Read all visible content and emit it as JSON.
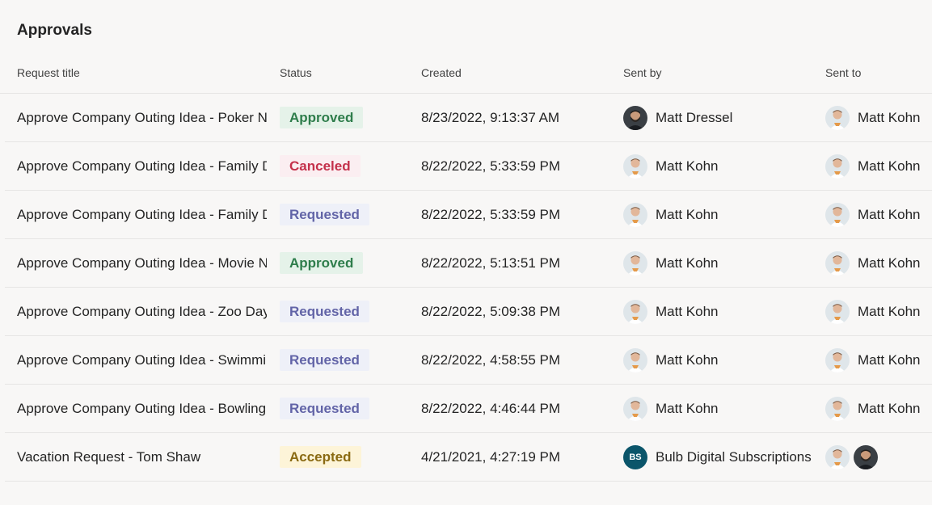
{
  "page": {
    "title": "Approvals"
  },
  "columns": {
    "title": "Request title",
    "status": "Status",
    "created": "Created",
    "sent_by": "Sent by",
    "sent_to": "Sent to"
  },
  "rows": [
    {
      "title": "Approve Company Outing Idea - Poker Night",
      "status": "Approved",
      "status_kind": "approved",
      "created": "8/23/2022, 9:13:37 AM",
      "sent_by": {
        "name": "Matt Dressel",
        "avatar": "bearded-man-avatar"
      },
      "sent_to": [
        {
          "name": "Matt Kohn",
          "avatar": "matt-kohn-avatar"
        }
      ]
    },
    {
      "title": "Approve Company Outing Idea - Family Day",
      "status": "Canceled",
      "status_kind": "canceled",
      "created": "8/22/2022, 5:33:59 PM",
      "sent_by": {
        "name": "Matt Kohn",
        "avatar": "matt-kohn-avatar"
      },
      "sent_to": [
        {
          "name": "Matt Kohn",
          "avatar": "matt-kohn-avatar"
        }
      ]
    },
    {
      "title": "Approve Company Outing Idea - Family Day",
      "status": "Requested",
      "status_kind": "requested",
      "created": "8/22/2022, 5:33:59 PM",
      "sent_by": {
        "name": "Matt Kohn",
        "avatar": "matt-kohn-avatar"
      },
      "sent_to": [
        {
          "name": "Matt Kohn",
          "avatar": "matt-kohn-avatar"
        }
      ]
    },
    {
      "title": "Approve Company Outing Idea - Movie Night",
      "status": "Approved",
      "status_kind": "approved",
      "created": "8/22/2022, 5:13:51 PM",
      "sent_by": {
        "name": "Matt Kohn",
        "avatar": "matt-kohn-avatar"
      },
      "sent_to": [
        {
          "name": "Matt Kohn",
          "avatar": "matt-kohn-avatar"
        }
      ]
    },
    {
      "title": "Approve Company Outing Idea - Zoo Day",
      "status": "Requested",
      "status_kind": "requested",
      "created": "8/22/2022, 5:09:38 PM",
      "sent_by": {
        "name": "Matt Kohn",
        "avatar": "matt-kohn-avatar"
      },
      "sent_to": [
        {
          "name": "Matt Kohn",
          "avatar": "matt-kohn-avatar"
        }
      ]
    },
    {
      "title": "Approve Company Outing Idea - Swimming",
      "status": "Requested",
      "status_kind": "requested",
      "created": "8/22/2022, 4:58:55 PM",
      "sent_by": {
        "name": "Matt Kohn",
        "avatar": "matt-kohn-avatar"
      },
      "sent_to": [
        {
          "name": "Matt Kohn",
          "avatar": "matt-kohn-avatar"
        }
      ]
    },
    {
      "title": "Approve Company Outing Idea - Bowling",
      "status": "Requested",
      "status_kind": "requested",
      "created": "8/22/2022, 4:46:44 PM",
      "sent_by": {
        "name": "Matt Kohn",
        "avatar": "matt-kohn-avatar"
      },
      "sent_to": [
        {
          "name": "Matt Kohn",
          "avatar": "matt-kohn-avatar"
        }
      ]
    },
    {
      "title": "Vacation Request - Tom Shaw",
      "status": "Accepted",
      "status_kind": "accepted",
      "created": "4/21/2021, 4:27:19 PM",
      "sent_by": {
        "name": "Bulb Digital Subscriptions",
        "initials": "BS",
        "color": "#0b556a"
      },
      "sent_to": [
        {
          "name": "",
          "avatar": "matt-kohn-avatar"
        },
        {
          "name": "",
          "avatar": "bearded-man-avatar"
        }
      ]
    }
  ]
}
